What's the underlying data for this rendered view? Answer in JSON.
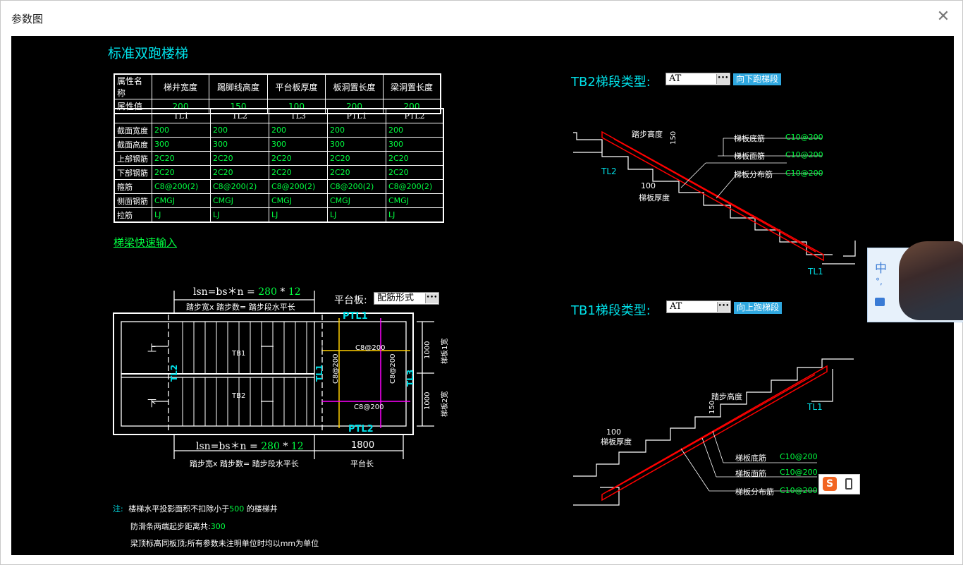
{
  "window": {
    "title": "参数图",
    "close_glyph": "✕"
  },
  "heading": "标准双跑楼梯",
  "props_table": {
    "headers": [
      "属性名称",
      "梯井宽度",
      "踢脚线高度",
      "平台板厚度",
      "板洞置长度",
      "梁洞置长度"
    ],
    "row_label": "属性值",
    "values": [
      "200",
      "150",
      "100",
      "200",
      "200"
    ]
  },
  "beam_table": {
    "columns": [
      "TL1",
      "TL2",
      "TL3",
      "PTL1",
      "PTL2"
    ],
    "rows": [
      {
        "label": "截面宽度",
        "cells": [
          "200",
          "200",
          "200",
          "200",
          "200"
        ]
      },
      {
        "label": "截面高度",
        "cells": [
          "300",
          "300",
          "300",
          "300",
          "300"
        ]
      },
      {
        "label": "上部钢筋",
        "cells": [
          "2C20",
          "2C20",
          "2C20",
          "2C20",
          "2C20"
        ]
      },
      {
        "label": "下部钢筋",
        "cells": [
          "2C20",
          "2C20",
          "2C20",
          "2C20",
          "2C20"
        ]
      },
      {
        "label": "箍筋",
        "cells": [
          "C8@200(2)",
          "C8@200(2)",
          "C8@200(2)",
          "C8@200(2)",
          "C8@200(2)"
        ]
      },
      {
        "label": "侧面钢筋",
        "cells": [
          "CMGJ",
          "CMGJ",
          "CMGJ",
          "CMGJ",
          "CMGJ"
        ]
      },
      {
        "label": "拉筋",
        "cells": [
          "LJ",
          "LJ",
          "LJ",
          "LJ",
          "LJ"
        ]
      }
    ]
  },
  "quick_link": "梯梁快速输入",
  "plan": {
    "formula_prefix": "lsn=bs＊n = ",
    "bs": "280",
    "times": " * ",
    "n": "12",
    "formula_caption": "踏步宽x 踏步数= 踏步段水平长",
    "platform_label": "平台板:",
    "platform_value": "配筋形式",
    "platform_len": "1800",
    "platform_len_caption": "平台长",
    "up": "上",
    "down": "下",
    "tb1": "TB1",
    "tb2": "TB2",
    "tl1": "TL1",
    "tl2": "TL2",
    "tl3": "TL3",
    "ptl1": "PTL1",
    "ptl2": "PTL2",
    "rebar1": "C8@200",
    "rebar2": "C8@200",
    "rebar3": "C8@200",
    "rebar4": "C8@200",
    "dim1": "1000",
    "dim2": "1000",
    "wide1": "梯板1宽",
    "wide2": "梯板2宽"
  },
  "tb2": {
    "label": "TB2梯段类型:",
    "select_value": "AT",
    "button": "向下跑梯段",
    "step_height": "踏步高度",
    "step_h_val": "150",
    "thick_val": "100",
    "thick": "梯板厚度",
    "bottom_bar": "梯板底筋",
    "bottom_bar_val": "C10@200",
    "top_bar": "梯板面筋",
    "top_bar_val": "C10@200",
    "dist_bar": "梯板分布筋",
    "dist_bar_val": "C10@200",
    "tl2": "TL2",
    "tl1": "TL1"
  },
  "tb1": {
    "label": "TB1梯段类型:",
    "select_value": "AT",
    "button": "向上跑梯段",
    "step_height": "踏步高度",
    "step_h_val": "150",
    "thick_val": "100",
    "thick": "梯板厚度",
    "bottom_bar": "梯板底筋",
    "bottom_bar_val": "C10@200",
    "top_bar": "梯板面筋",
    "top_bar_val": "C10@200",
    "dist_bar": "梯板分布筋",
    "dist_bar_val": "C10@200",
    "tl1": "TL1"
  },
  "notes": {
    "prefix": "注:",
    "line1_a": "楼梯水平投影面积不扣除小于",
    "line1_val": "500",
    "line1_b": " 的楼梯井",
    "line2_a": "防滑条两端起步距离共:",
    "line2_val": "300",
    "line3": "梁顶标高同板顶;所有参数未注明单位时均以mm为单位"
  },
  "ime": {
    "lang": "中",
    "punct": "°,"
  },
  "colors": {
    "canvas": "#000000",
    "cyan": "#00e0e8",
    "green": "#00ff40",
    "red": "#ff0000",
    "yellow": "#ffff00",
    "magenta": "#ff00ff",
    "button": "#2fa8e0"
  }
}
